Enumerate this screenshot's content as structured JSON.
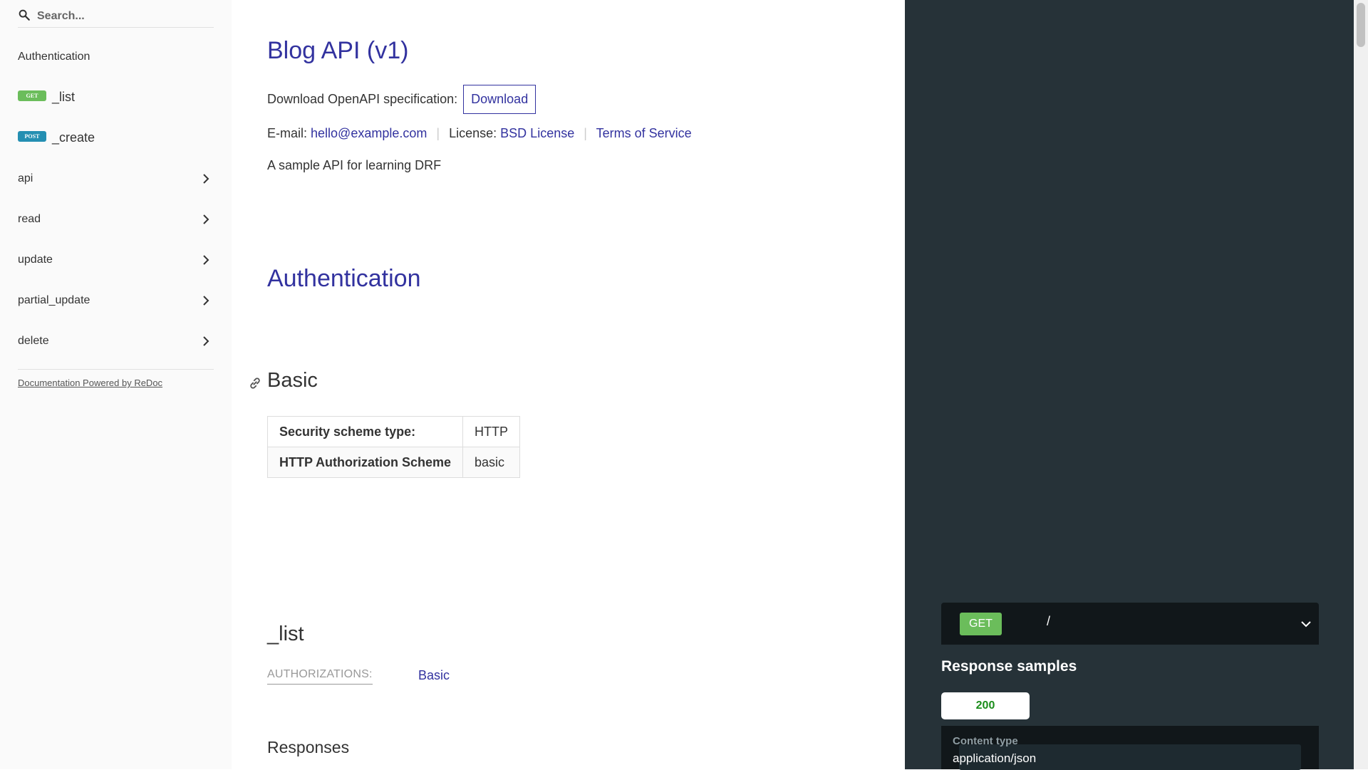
{
  "sidebar": {
    "search_placeholder": "Search...",
    "items": [
      {
        "label": "Authentication"
      },
      {
        "label": "_list",
        "method": "GET"
      },
      {
        "label": "_create",
        "method": "POST"
      },
      {
        "label": "api"
      },
      {
        "label": "read"
      },
      {
        "label": "update"
      },
      {
        "label": "partial_update"
      },
      {
        "label": "delete"
      }
    ],
    "powered_by": "Documentation Powered by ReDoc"
  },
  "main": {
    "title": "Blog API (v1)",
    "download_text": "Download OpenAPI specification:",
    "download_button": "Download",
    "email_label": "E-mail:",
    "email": "hello@example.com",
    "license_label": "License:",
    "license": "BSD License",
    "terms": "Terms of Service",
    "description": "A sample API for learning DRF",
    "auth_section": "Authentication",
    "basic": {
      "title": "Basic",
      "rows": [
        {
          "key": "Security scheme type:",
          "value": "HTTP"
        },
        {
          "key": "HTTP Authorization Scheme",
          "value": "basic"
        }
      ]
    },
    "list_op": {
      "title": "_list",
      "auth_label": "AUTHORIZATIONS:",
      "auth_value": "Basic",
      "responses_title": "Responses"
    }
  },
  "right_panel": {
    "method": "GET",
    "path": "/",
    "samples_title": "Response samples",
    "status_tab": "200",
    "content_type_label": "Content type",
    "content_type_value": "application/json"
  },
  "colors": {
    "accent": "#32329f",
    "get": "#6bbd5b",
    "post": "#248fb2",
    "right_panel_bg": "#263238"
  }
}
